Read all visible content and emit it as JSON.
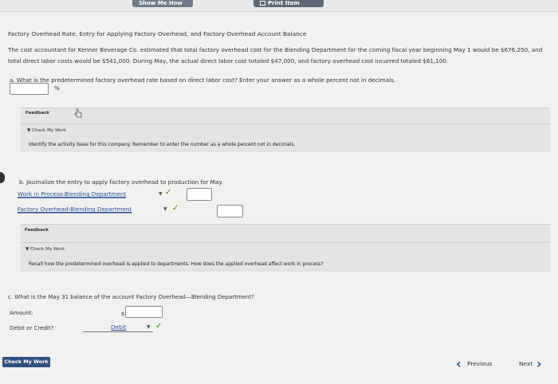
{
  "top": {
    "show_me_how": "Show Me How",
    "print_item": "Print Item"
  },
  "problem": {
    "title": "Factory Overhead Rate, Entry for Applying Factory Overhead, and Factory Overhead Account Balance",
    "description": "The cost accountant for Kenner Beverage Co. estimated that total factory overhead cost for the Blending Department for the coming fiscal year beginning May 1 would be $676,250, and total direct labor costs would be $541,000. During May, the actual direct labor cost totaled $47,000, and factory overhead cost incurred totaled $61,100."
  },
  "part_a": {
    "question": "a.  What is the predetermined factory overhead rate based on direct labor cost? Enter your answer as a whole percent not in decimals.",
    "value": "",
    "suffix": "%",
    "feedback_label": "Feedback",
    "check_title": "▼ Check My Work",
    "check_text": "Identify the activity base for this company. Remember to enter the number as a whole percent not in decimals."
  },
  "part_b": {
    "question": "b.  Journalize the entry to apply factory overhead to production for May.",
    "debit_account": "Work in Process-Blending Department",
    "credit_account": "Factory Overhead-Blending Department",
    "debit_amount": "",
    "credit_amount": "",
    "feedback_label": "Feedback",
    "check_title": "▼ Check My Work",
    "check_text": "Recall how the predetermined overhead is applied to departments. How does the applied overhead affect work in process?"
  },
  "part_c": {
    "question": "c.  What is the May 31 balance of the account Factory Overhead—Blending Department?",
    "amount_label": "Amount:",
    "currency": "$",
    "amount_value": "",
    "debit_credit_label": "Debit or Credit?",
    "debit_credit_value": "Debit"
  },
  "footer": {
    "check_my_work": "Check My Work",
    "previous": "Previous",
    "next": "Next"
  },
  "colors": {
    "link": "#2e4f9b",
    "check": "#3c8a2a",
    "button": "#2f4f7f",
    "nav": "#2a4fa0"
  }
}
